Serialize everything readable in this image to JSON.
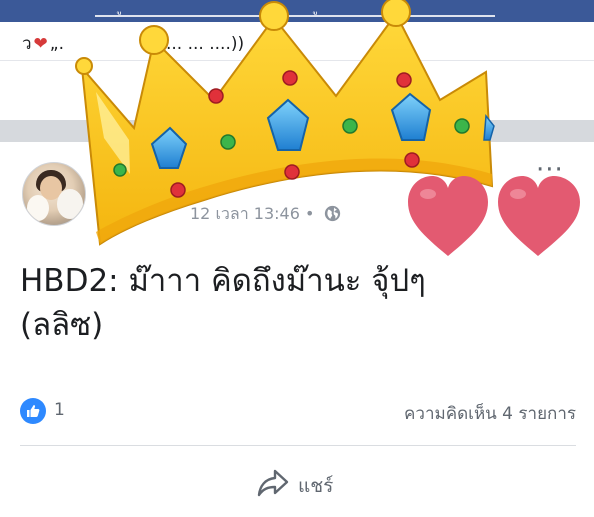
{
  "top_bar": {
    "color": "#3b5998",
    "fragments": [
      "ู",
      "ู"
    ]
  },
  "prev_post": {
    "text_prefix": "ว",
    "text_middle": "„.",
    "text_suffix": "ou ... ... ....))",
    "stub": "ๆ"
  },
  "post": {
    "meta": "12 เวลา 13:46 •",
    "text_line1": "HBD2: ม๊าาา คิดถึงม๊านะ จุ้ปๆ",
    "text_line2": "(ลลิซ)",
    "likes": "1",
    "comments": "ความคิดเห็น 4 รายการ",
    "share_label": "แชร์"
  },
  "colors": {
    "like_blue": "#2e89ff",
    "feed_gap": "#d6d9dd",
    "crown_gold": "#f7c51e",
    "gem_blue": "#39a8e8",
    "heart_pink": "#e35a71"
  },
  "icons": {
    "globe": "globe-icon",
    "like": "thumbs-up-icon",
    "share": "share-arrow-icon",
    "more": "more-dots-icon"
  }
}
